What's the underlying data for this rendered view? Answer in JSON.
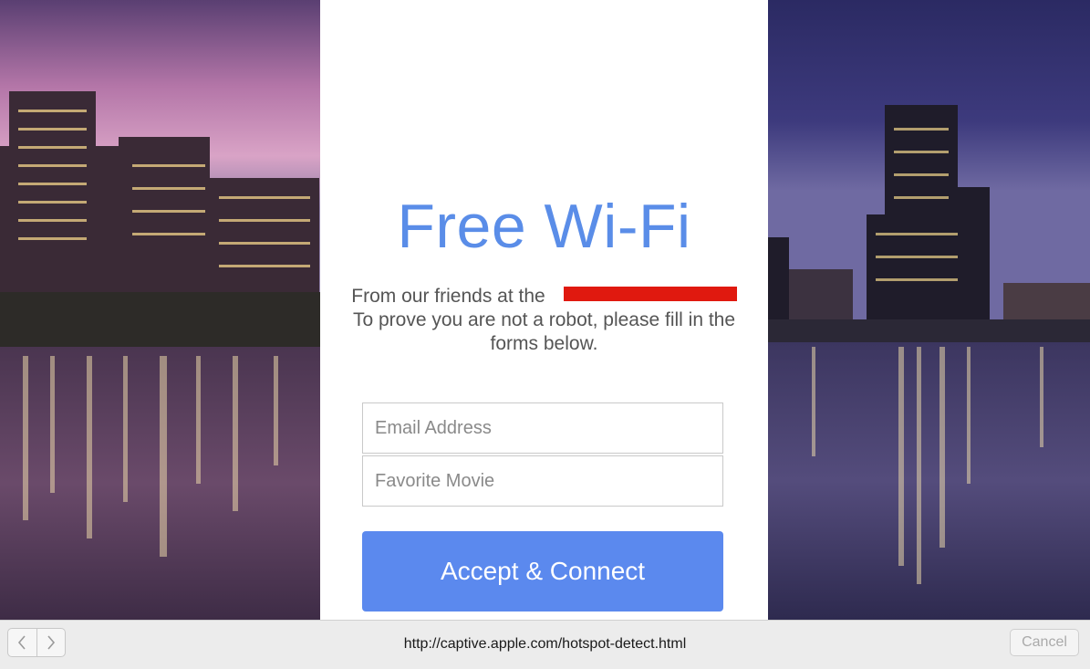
{
  "page": {
    "title": "Free Wi-Fi",
    "message_line1": "From our friends at the",
    "message_line2": "To prove you are not a robot, please fill in the",
    "message_line3": "forms below."
  },
  "form": {
    "email_placeholder": "Email Address",
    "movie_placeholder": "Favorite Movie",
    "submit_label": "Accept & Connect"
  },
  "toolbar": {
    "back_icon": "chevron-left-icon",
    "forward_icon": "chevron-right-icon",
    "url": "http://captive.apple.com/hotspot-detect.html",
    "cancel_label": "Cancel"
  },
  "colors": {
    "title": "#5a8de8",
    "button": "#5b89ee",
    "redaction": "#e0190f"
  }
}
